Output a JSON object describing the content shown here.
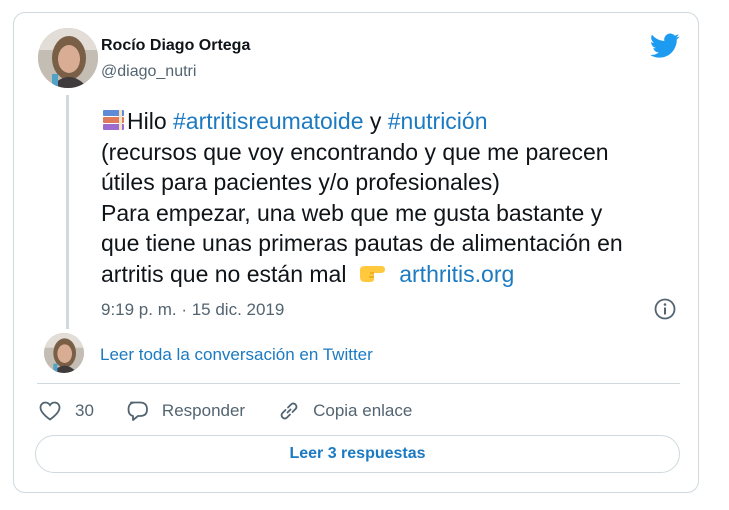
{
  "author": {
    "name": "Rocío Diago Ortega",
    "handle": "@diago_nutri"
  },
  "tweet": {
    "line1": {
      "emoji": "books-emoji",
      "prefix": "Hilo ",
      "hashtag1": "#artritisreumatoide",
      "middle": " y ",
      "hashtag2": "#nutrición"
    },
    "line2": "(recursos que voy encontrando y que me parecen",
    "line3": "útiles para pacientes y/o profesionales)",
    "line4": "Para empezar, una web que me gusta bastante y",
    "line5": "que tiene unas primeras pautas de alimentación en",
    "line6": {
      "text": "artritis que no están mal",
      "emoji": "pointing-right-emoji",
      "link": "arthritis.org"
    },
    "timestamp": "9:19 p. m. · 15 dic. 2019"
  },
  "conversation": {
    "read_label": "Leer toda la conversación en Twitter"
  },
  "actions": {
    "like_count": "30",
    "reply_label": "Responder",
    "copy_label": "Copia enlace"
  },
  "replies_button": "Leer 3 respuestas",
  "colors": {
    "link": "#1b7ac1",
    "twitter_blue": "#1d9bf0",
    "border": "#cfd9de",
    "secondary_text": "#536471"
  },
  "icons": [
    "twitter-logo-icon",
    "info-icon",
    "heart-icon",
    "reply-icon",
    "link-icon"
  ]
}
